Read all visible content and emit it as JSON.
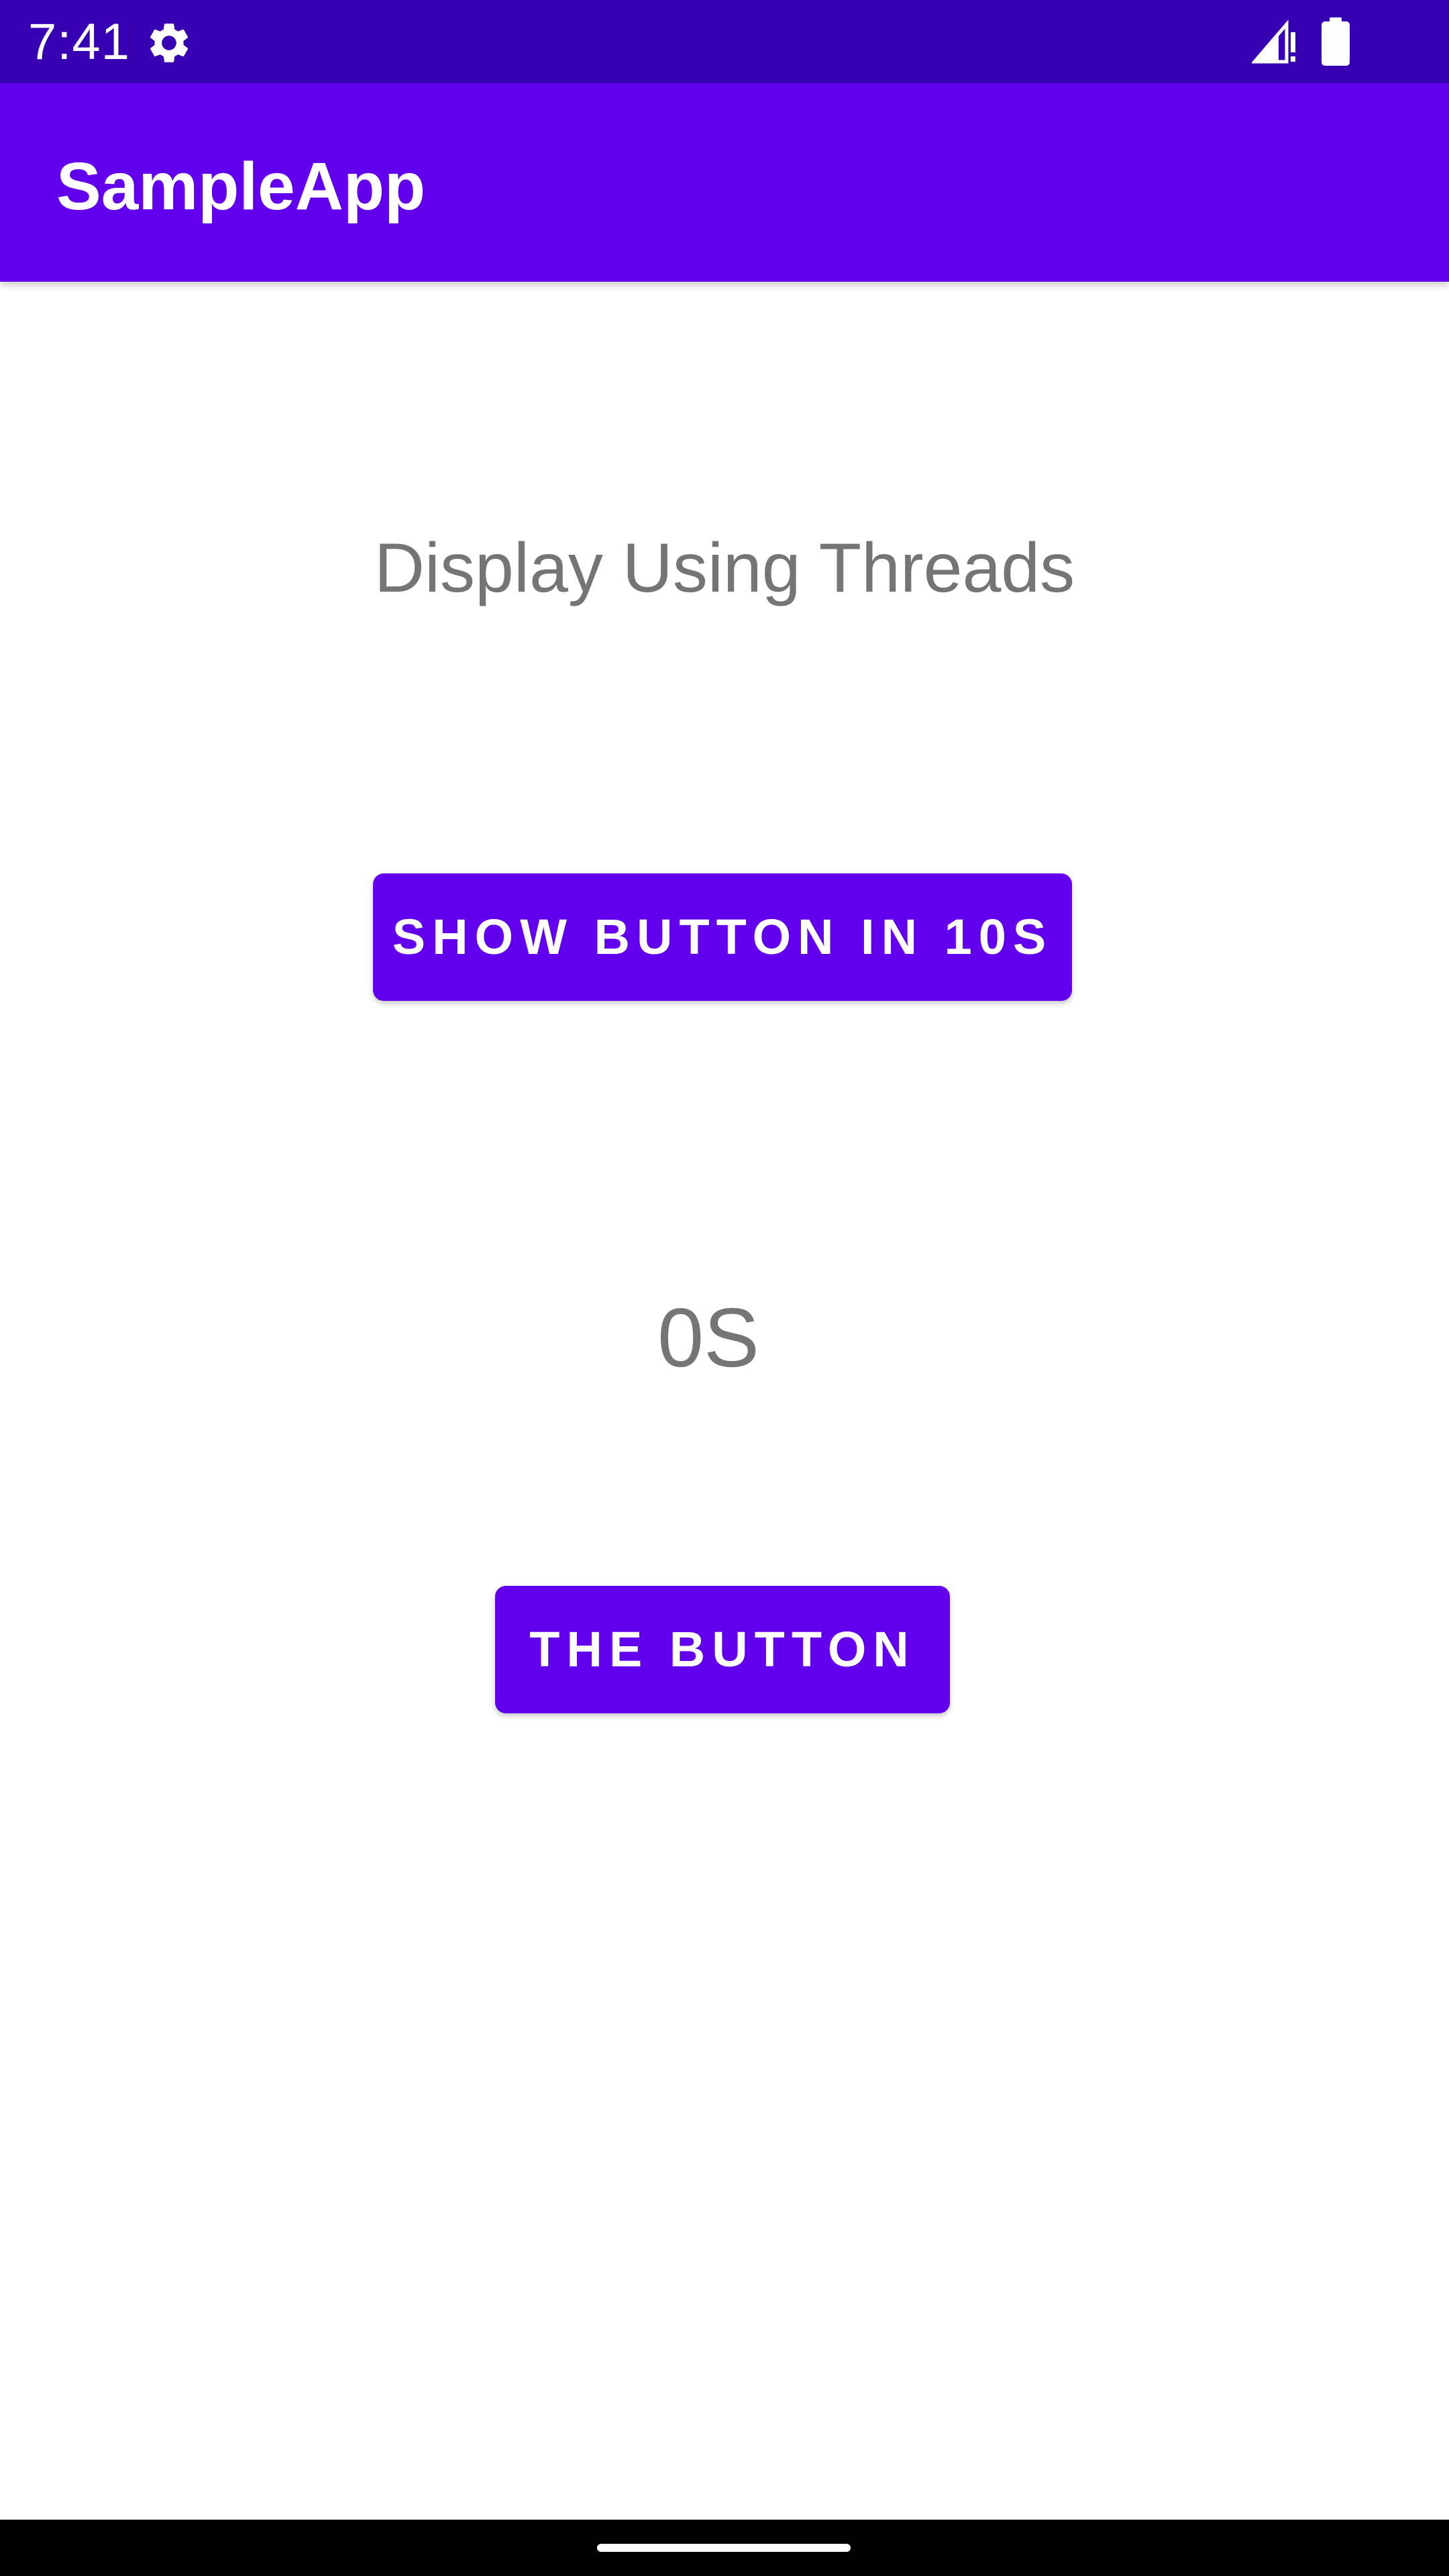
{
  "status_bar": {
    "time": "7:41",
    "icons": [
      "gear-icon",
      "signal-icon",
      "battery-icon"
    ],
    "background": "#3700B3"
  },
  "app_bar": {
    "title": "SampleApp",
    "background": "#6200EE"
  },
  "main": {
    "heading": "Display Using Threads",
    "show_button_label": "SHOW BUTTON IN 10S",
    "counter_text": "0S",
    "the_button_label": "THE BUTTON"
  },
  "colors": {
    "accent": "#6200EE",
    "text_secondary": "#757575"
  }
}
